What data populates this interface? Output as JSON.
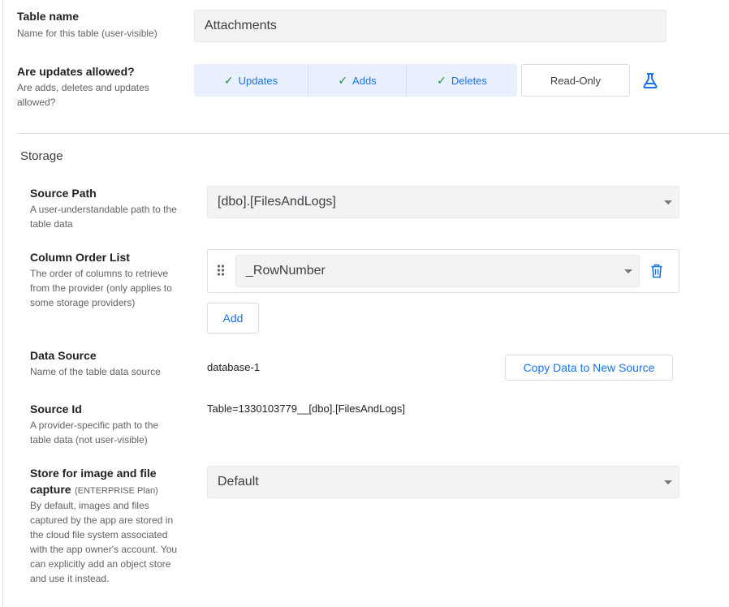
{
  "table_name": {
    "title": "Table name",
    "desc": "Name for this table (user-visible)",
    "value": "Attachments"
  },
  "updates": {
    "title": "Are updates allowed?",
    "desc_line1": "Are adds, deletes and updates",
    "desc_line2": "allowed?",
    "options": [
      "Updates",
      "Adds",
      "Deletes"
    ],
    "readonly_label": "Read-Only",
    "flask_icon": "flask-icon"
  },
  "storage": {
    "heading": "Storage",
    "source_path": {
      "title": "Source Path",
      "desc_line1": "A user-understandable path to the",
      "desc_line2": "table data",
      "value": "[dbo].[FilesAndLogs]"
    },
    "column_order": {
      "title": "Column Order List",
      "desc_line1": "The order of columns to retrieve",
      "desc_line2": "from the provider (only applies to",
      "desc_line3": "some storage providers)",
      "value": "_RowNumber",
      "add_label": "Add"
    },
    "data_source": {
      "title": "Data Source",
      "desc": "Name of the table data source",
      "value": "database-1",
      "copy_label": "Copy Data to New Source"
    },
    "source_id": {
      "title": "Source Id",
      "desc_line1": "A provider-specific path to the",
      "desc_line2": "table data (not user-visible)",
      "value": "Table=1330103779__[dbo].[FilesAndLogs]"
    },
    "store": {
      "title_line1": "Store for image and file",
      "title_line2": "capture",
      "plan": "(ENTERPRISE Plan)",
      "desc_lines": [
        "By default, images and files",
        "captured by the app are stored in",
        "the cloud file system associated",
        "with the app owner's account. You",
        "can explicitly add an object store",
        "and use it instead."
      ],
      "value": "Default"
    }
  },
  "colors": {
    "accent": "#1a73e8",
    "check": "#1e8e3e",
    "field_bg": "#f1f3f4",
    "segment_bg": "#e8f0fe"
  }
}
